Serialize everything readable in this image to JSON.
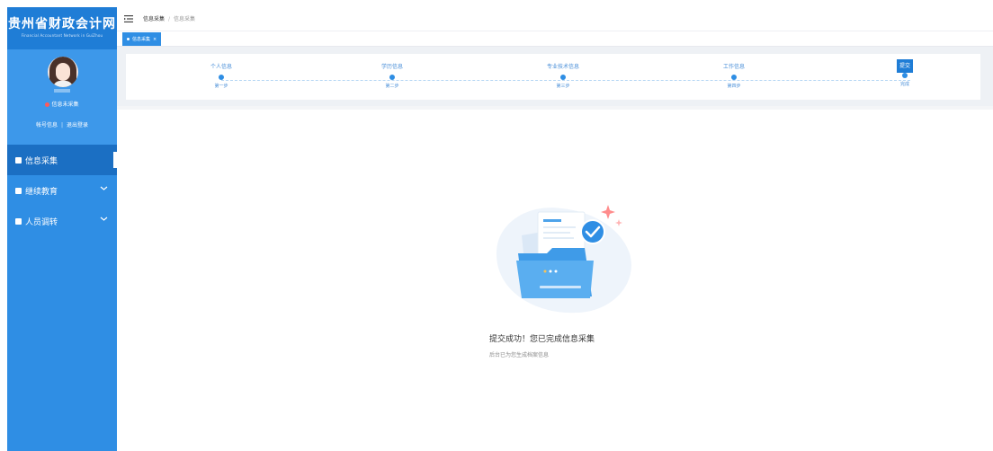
{
  "brand": {
    "title": "贵州省财政会计网",
    "subtitle": "Financial Accountant Network in GuiZhou"
  },
  "profile": {
    "status": "信息未采集",
    "account_link": "帐号信息",
    "separator": "|",
    "logout_link": "退出登录"
  },
  "menu": [
    {
      "label": "信息采集",
      "active": true
    },
    {
      "label": "继续教育",
      "active": false
    },
    {
      "label": "人员调转",
      "active": false
    }
  ],
  "breadcrumb": {
    "root": "信息采集",
    "separator": "/",
    "current": "信息采集"
  },
  "tabs": [
    {
      "label": "信息采集",
      "close": "×"
    }
  ],
  "steps": [
    {
      "label": "个人信息",
      "sub": "第一步"
    },
    {
      "label": "学历信息",
      "sub": "第二步"
    },
    {
      "label": "专业技术信息",
      "sub": "第三步"
    },
    {
      "label": "工作信息",
      "sub": "第四步"
    },
    {
      "label": "提交",
      "sub": "完成"
    }
  ],
  "result": {
    "message": "提交成功！您已完成信息采集",
    "detail": "后台已为您生成档案信息"
  },
  "colors": {
    "sidebar": "#2f8ee4",
    "accent": "#1f7dd6",
    "status_dot": "#ff5a5a"
  }
}
